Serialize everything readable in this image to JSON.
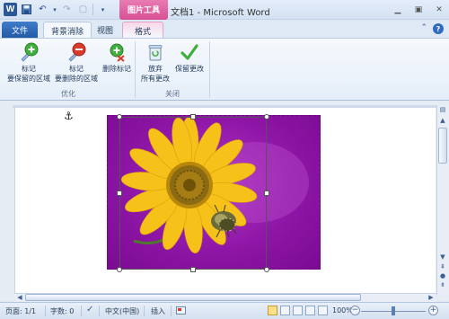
{
  "window": {
    "title": "文档1 - Microsoft Word",
    "context_tab": "图片工具",
    "app_icon": "W"
  },
  "tabs": [
    {
      "label": "文件"
    },
    {
      "label": "背景消除"
    },
    {
      "label": "视图"
    },
    {
      "label": "格式"
    }
  ],
  "ribbon": {
    "buttons": [
      {
        "line1": "标记",
        "line2": "要保留的区域"
      },
      {
        "line1": "标记",
        "line2": "要删除的区域"
      },
      {
        "line1": "删除标记",
        "line2": ""
      },
      {
        "line1": "放弃",
        "line2": "所有更改"
      },
      {
        "line1": "保留更改",
        "line2": ""
      }
    ],
    "groups": [
      {
        "label": "优化"
      },
      {
        "label": "关闭"
      }
    ]
  },
  "statusbar": {
    "page": "页面: 1/1",
    "words": "字数: 0",
    "language": "中文(中国)",
    "mode": "插入",
    "zoom": "100%"
  },
  "colors": {
    "keep_green": "#3fae3c",
    "delete_red": "#d83a2c",
    "removed_bg": "#9a1fb3",
    "flower": "#f6c21a"
  }
}
